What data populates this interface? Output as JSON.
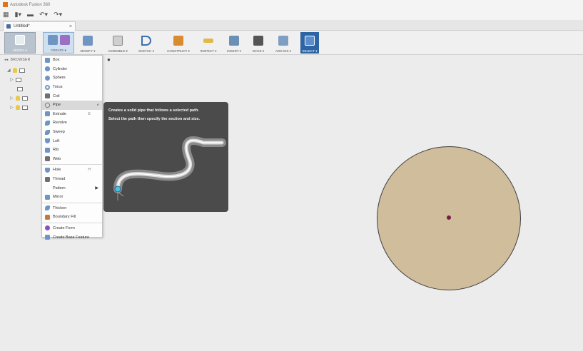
{
  "app": {
    "title": "Autodesk Fusion 360"
  },
  "document_tab": {
    "label": "Untitled*",
    "close": "×"
  },
  "quick_access": {
    "grid": "▦",
    "file": "▮▾",
    "save": "▬",
    "undo": "↶▾",
    "redo": "↷▾"
  },
  "toolbar": {
    "model": "MODEL ▾",
    "create": "CREATE ▾",
    "modify": "MODIFY ▾",
    "assemble": "ASSEMBLE ▾",
    "sketch": "SKETCH ▾",
    "construct": "CONSTRUCT ▾",
    "inspect": "INSPECT ▾",
    "insert": "INSERT ▾",
    "make": "MAKE ▾",
    "addins": "ADD-INS ▾",
    "select": "SELECT ▾"
  },
  "browser": {
    "label": "BROWSER",
    "collapse": "◂◂",
    "pin": "●"
  },
  "create_menu": {
    "items": [
      {
        "label": "Box",
        "color": "#6f95c4"
      },
      {
        "label": "Cylinder",
        "color": "#6f95c4"
      },
      {
        "label": "Sphere",
        "color": "#6f95c4"
      },
      {
        "label": "Torus",
        "color": "#6f95c4"
      },
      {
        "label": "Coil",
        "color": "#6f6f6f"
      },
      {
        "label": "Pipe",
        "color": "#8a8a8a",
        "pin": "⤶"
      },
      {
        "label": "Extrude",
        "color": "#6f95c4",
        "shortcut": "E"
      },
      {
        "label": "Revolve",
        "color": "#6f95c4"
      },
      {
        "label": "Sweep",
        "color": "#6f95c4"
      },
      {
        "label": "Loft",
        "color": "#6f95c4"
      },
      {
        "label": "Rib",
        "color": "#6f95c4"
      },
      {
        "label": "Web",
        "color": "#6f6f6f"
      },
      {
        "label": "Hole",
        "color": "#6f95c4",
        "shortcut": "H"
      },
      {
        "label": "Thread",
        "color": "#6f6f6f"
      },
      {
        "label": "Pattern",
        "arrow": "▶"
      },
      {
        "label": "Mirror",
        "color": "#6f95c4"
      },
      {
        "label": "Thicken",
        "color": "#6f95c4"
      },
      {
        "label": "Boundary Fill",
        "color": "#c27a3b"
      },
      {
        "label": "Create Form",
        "color": "#8a4fbf"
      },
      {
        "label": "Create Base Feature",
        "color": "#6f95c4"
      }
    ]
  },
  "tooltip": {
    "line1": "Creates a solid pipe that follows a selected path.",
    "line2": "Select the path then specify the section and size."
  }
}
